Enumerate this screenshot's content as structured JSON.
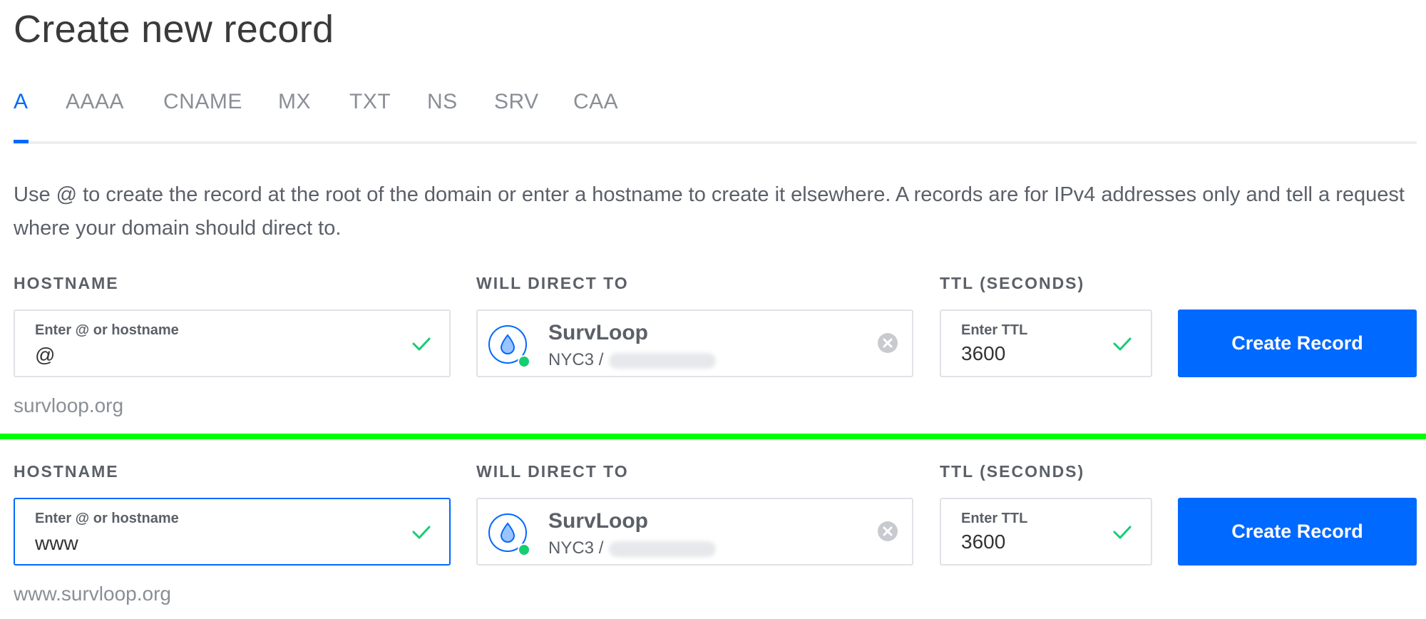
{
  "page": {
    "title": "Create new record"
  },
  "tabs": [
    {
      "label": "A",
      "active": true
    },
    {
      "label": "AAAA"
    },
    {
      "label": "CNAME"
    },
    {
      "label": "MX"
    },
    {
      "label": "TXT"
    },
    {
      "label": "NS"
    },
    {
      "label": "SRV"
    },
    {
      "label": "CAA"
    }
  ],
  "description": "Use @ to create the record at the root of the domain or enter a hostname to create it elsewhere. A records are for IPv4 addresses only and tell a request where your domain should direct to.",
  "labels": {
    "hostname": "HOSTNAME",
    "direct": "WILL DIRECT TO",
    "ttl": "TTL (SECONDS)"
  },
  "form1": {
    "hostname_label": "Enter @ or hostname",
    "hostname_value": "@",
    "dest_name": "SurvLoop",
    "dest_region": "NYC3 /",
    "ttl_label": "Enter TTL",
    "ttl_value": "3600",
    "button": "Create Record",
    "hint": "survloop.org"
  },
  "form2": {
    "hostname_label": "Enter @ or hostname",
    "hostname_value": "www",
    "dest_name": "SurvLoop",
    "dest_region": "NYC3 /",
    "ttl_label": "Enter TTL",
    "ttl_value": "3600",
    "button": "Create Record",
    "hint": "www.survloop.org"
  },
  "colors": {
    "accent": "#0069ff",
    "success": "#15cd72",
    "divider": "#00ff00"
  },
  "icons": {
    "valid": "check-icon",
    "destination": "droplet-icon",
    "clear": "clear-icon"
  }
}
